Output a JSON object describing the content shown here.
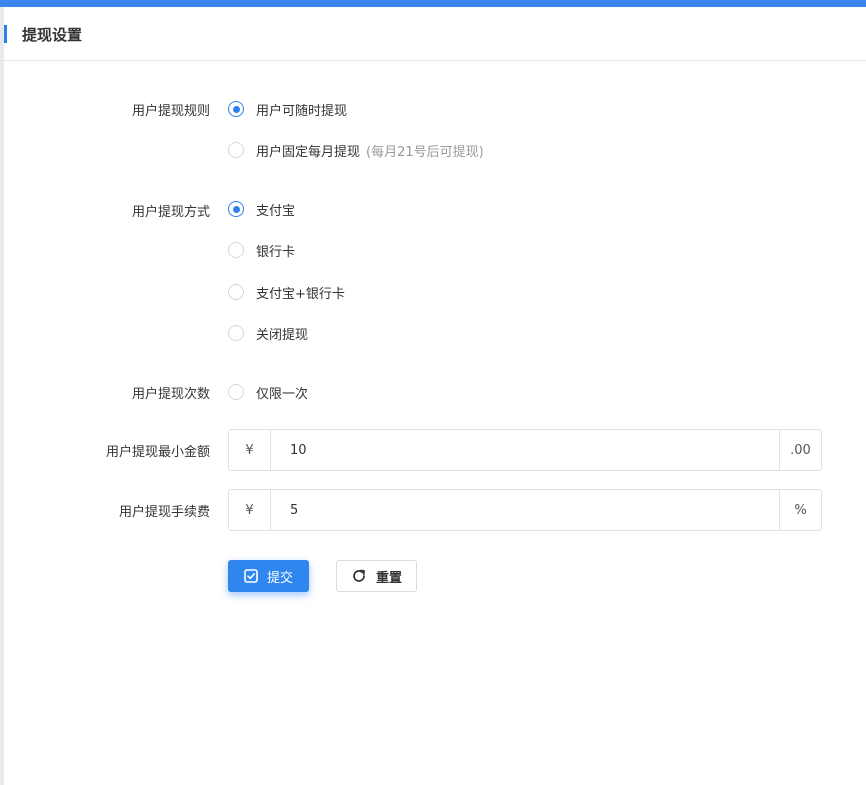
{
  "header": {
    "title": "提现设置"
  },
  "rule": {
    "label": "用户提现规则",
    "options": [
      {
        "text": "用户可随时提现",
        "hint": "",
        "checked": true
      },
      {
        "text": "用户固定每月提现",
        "hint": "(每月21号后可提现)",
        "checked": false
      }
    ]
  },
  "method": {
    "label": "用户提现方式",
    "options": [
      {
        "text": "支付宝",
        "checked": true
      },
      {
        "text": "银行卡",
        "checked": false
      },
      {
        "text": "支付宝+银行卡",
        "checked": false
      },
      {
        "text": "关闭提现",
        "checked": false
      }
    ]
  },
  "count": {
    "label": "用户提现次数",
    "option": {
      "text": "仅限一次",
      "checked": false
    }
  },
  "min_amount": {
    "label": "用户提现最小金额",
    "prefix": "¥",
    "value": "10",
    "suffix": ".00"
  },
  "fee": {
    "label": "用户提现手续费",
    "prefix": "¥",
    "value": "5",
    "suffix": "%"
  },
  "buttons": {
    "submit": "提交",
    "reset": "重置"
  },
  "colors": {
    "primary": "#2f86ef",
    "top_bar": "#3a86ea"
  },
  "icons": {
    "submit": "check-square-icon",
    "reset": "refresh-icon"
  }
}
